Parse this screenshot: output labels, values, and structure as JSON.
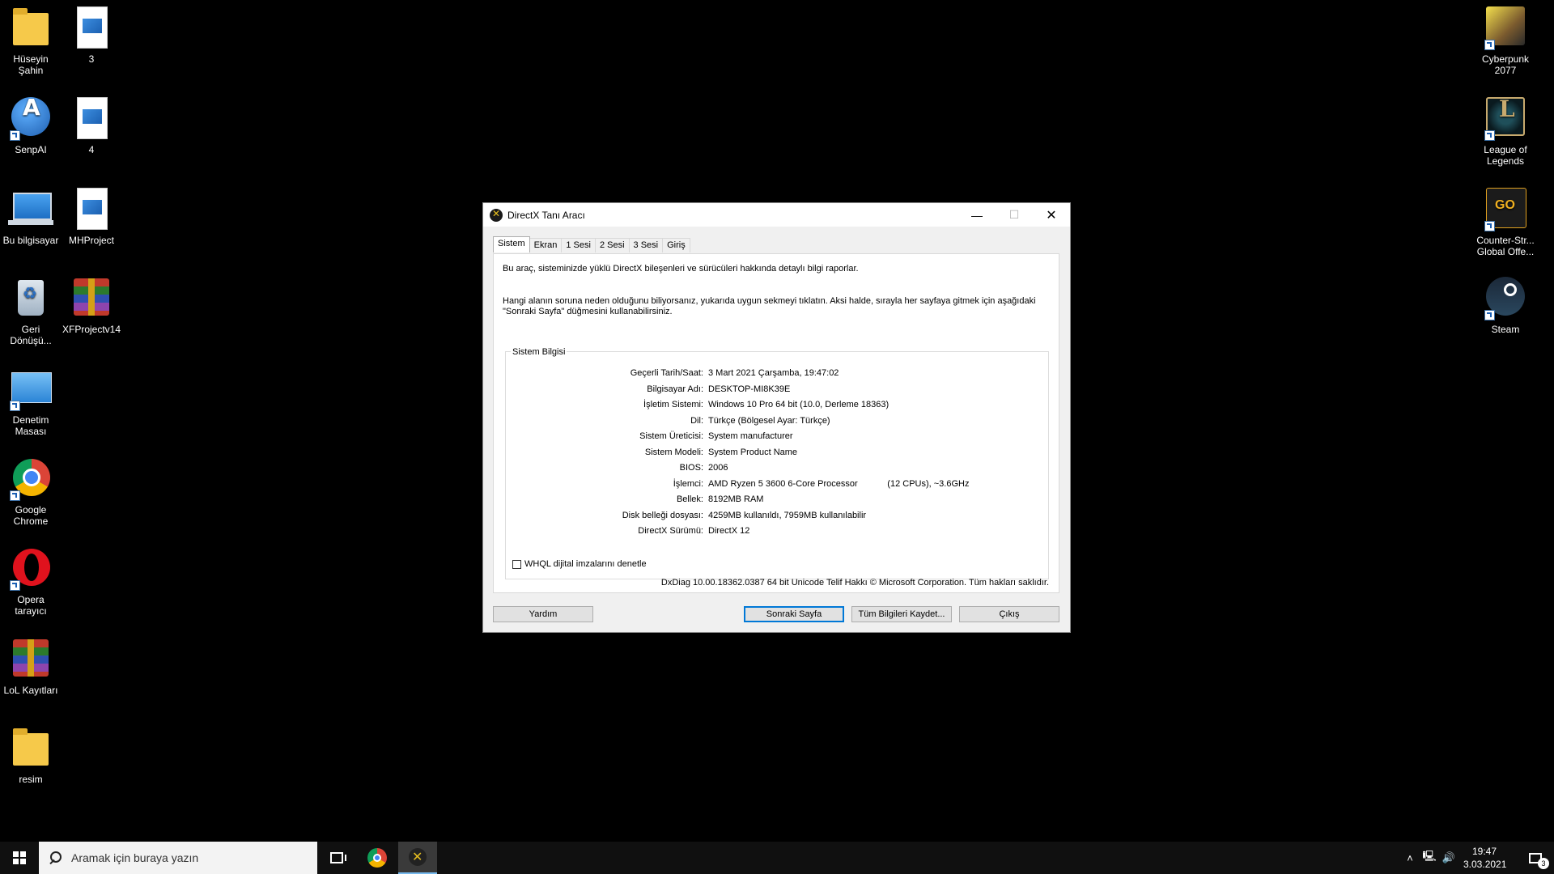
{
  "desktop_icons": [
    {
      "label": "Hüseyin Şahin",
      "icon": "user-folder-icon"
    },
    {
      "label": "3",
      "icon": "image-file-icon"
    },
    {
      "label": "SenpAI",
      "icon": "senpai-app-icon"
    },
    {
      "label": "4",
      "icon": "image-file-icon"
    },
    {
      "label": "Bu bilgisayar",
      "icon": "computer-icon"
    },
    {
      "label": "MHProject",
      "icon": "file-icon"
    },
    {
      "label": "Geri Dönüşü...",
      "icon": "recycle-bin-icon"
    },
    {
      "label": "XFProjectv14",
      "icon": "winrar-archive-icon"
    },
    {
      "label": "Denetim Masası",
      "icon": "control-panel-icon"
    },
    {
      "label": "Google Chrome",
      "icon": "chrome-icon"
    },
    {
      "label": "Opera tarayıcı",
      "icon": "opera-icon"
    },
    {
      "label": "LoL Kayıtları",
      "icon": "winrar-archive-icon"
    },
    {
      "label": "resim",
      "icon": "folder-icon"
    },
    {
      "label": "Cyberpunk 2077",
      "icon": "cyberpunk-game-icon"
    },
    {
      "label": "League of Legends",
      "icon": "lol-game-icon"
    },
    {
      "label": "Counter-Str... Global Offe...",
      "icon": "csgo-game-icon"
    },
    {
      "label": "Steam",
      "icon": "steam-icon"
    }
  ],
  "dialog": {
    "title": "DirectX Tanı Aracı",
    "tabs": [
      "Sistem",
      "Ekran",
      "1 Sesi",
      "2 Sesi",
      "3 Sesi",
      "Giriş"
    ],
    "active_tab": "Sistem",
    "intro1": "Bu araç, sisteminizde yüklü DirectX bileşenleri ve sürücüleri hakkında detaylı bilgi raporlar.",
    "intro2": "Hangi alanın soruna neden olduğunu biliyorsanız, yukarıda uygun sekmeyi tıklatın. Aksi halde, sırayla her sayfaya gitmek için aşağıdaki \"Sonraki Sayfa\" düğmesini kullanabilirsiniz.",
    "group_label": "Sistem Bilgisi",
    "info_rows": [
      {
        "label": "Geçerli Tarih/Saat:",
        "value": "3 Mart 2021 Çarşamba, 19:47:02"
      },
      {
        "label": "Bilgisayar Adı:",
        "value": "DESKTOP-MI8K39E"
      },
      {
        "label": "İşletim Sistemi:",
        "value": "Windows 10 Pro 64 bit (10.0, Derleme 18363)"
      },
      {
        "label": "Dil:",
        "value": "Türkçe (Bölgesel Ayar: Türkçe)"
      },
      {
        "label": "Sistem Üreticisi:",
        "value": "System manufacturer"
      },
      {
        "label": "Sistem Modeli:",
        "value": "System Product Name"
      },
      {
        "label": "BIOS:",
        "value": "2006"
      },
      {
        "label": "İşlemci:",
        "value": "AMD Ryzen 5 3600 6-Core Processor            (12 CPUs), ~3.6GHz"
      },
      {
        "label": "Bellek:",
        "value": "8192MB RAM"
      },
      {
        "label": "Disk belleği dosyası:",
        "value": "4259MB kullanıldı, 7959MB kullanılabilir"
      },
      {
        "label": "DirectX Sürümü:",
        "value": "DirectX 12"
      }
    ],
    "whql_label": "WHQL dijital imzalarını denetle",
    "whql_checked": false,
    "footer": "DxDiag 10.00.18362.0387 64 bit Unicode  Telif Hakkı © Microsoft Corporation. Tüm hakları saklıdır.",
    "buttons": {
      "help": "Yardım",
      "next": "Sonraki Sayfa",
      "save_all": "Tüm Bilgileri Kaydet...",
      "exit": "Çıkış"
    }
  },
  "taskbar": {
    "search_placeholder": "Aramak için buraya yazın",
    "time": "19:47",
    "date": "3.03.2021",
    "notification_count": "3"
  }
}
